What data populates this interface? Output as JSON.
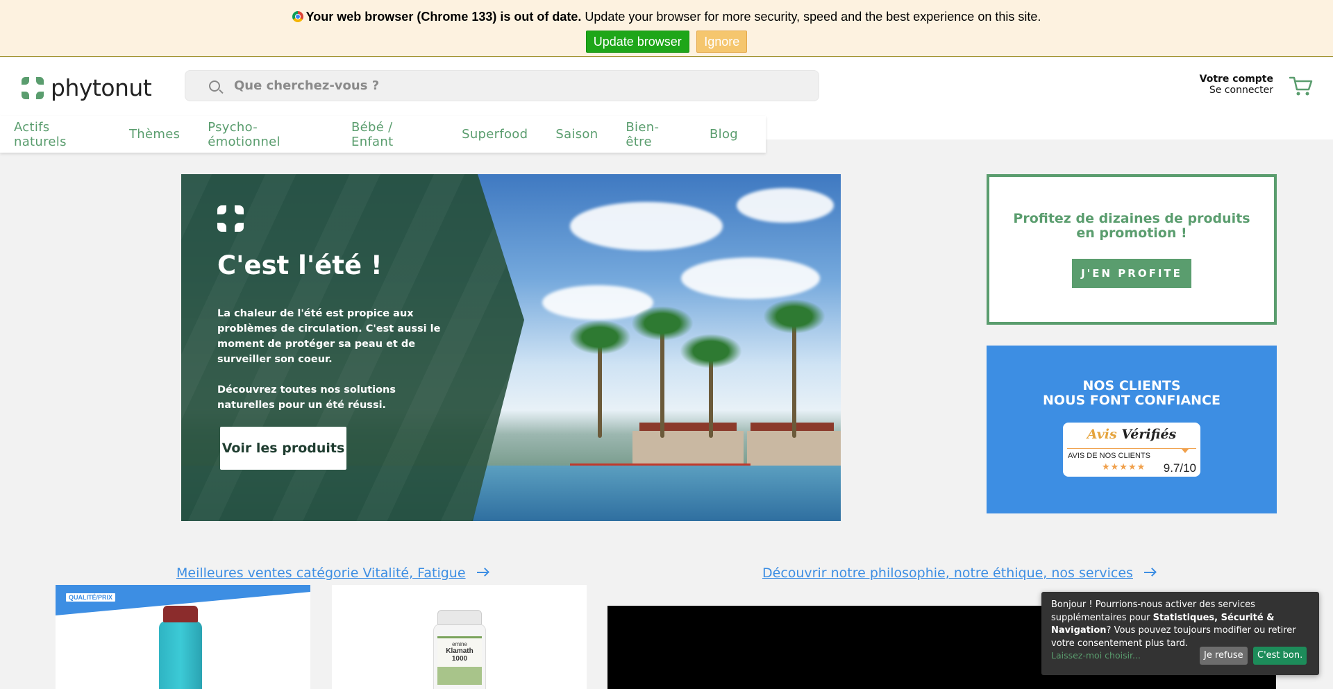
{
  "browser_warning": {
    "bold_text": "Your web browser (Chrome 133) is out of date.",
    "text": " Update your browser for more security, speed and the best experience on this site.",
    "update_label": "Update browser",
    "ignore_label": "Ignore"
  },
  "header": {
    "logo_text": "phytonut",
    "search_placeholder": "Que cherchez-vous ?",
    "account_title": "Votre compte",
    "account_login": "Se connecter"
  },
  "nav": {
    "items": [
      {
        "label": "Actifs naturels"
      },
      {
        "label": "Thèmes"
      },
      {
        "label": "Psycho-émotionnel"
      },
      {
        "label": "Bébé / Enfant"
      },
      {
        "label": "Superfood"
      },
      {
        "label": "Saison"
      },
      {
        "label": "Bien-être"
      },
      {
        "label": "Blog"
      }
    ]
  },
  "hero": {
    "title": "C'est l'été !",
    "paragraph1": "La chaleur de l'été est propice aux problèmes de circulation. C'est aussi le moment de protéger sa peau et de surveiller son coeur.",
    "paragraph2": "Découvrez toutes nos solutions naturelles pour un été réussi.",
    "button_label": "Voir les produits"
  },
  "promo": {
    "text": "Profitez de dizaines de produits en promotion !",
    "button_label": "J'EN PROFITE"
  },
  "trust": {
    "title_line1": "NOS CLIENTS",
    "title_line2": "NOUS FONT CONFIANCE",
    "brand_a": "Avis",
    "brand_b": "Vérifiés",
    "subtitle": "AVIS DE NOS CLIENTS",
    "stars": "★★★★★",
    "score": "9.7/10"
  },
  "links": {
    "best_sellers": "Meilleures ventes catégorie Vitalité, Fatigue",
    "philosophy": "Découvrir notre philosophie, notre éthique, nos services"
  },
  "products": {
    "badge": "QUALITÉ/PRIX",
    "card2_brand": "emine",
    "card2_name": "Klamath 1000"
  },
  "cookie": {
    "text_before": "Bonjour ! Pourrions-nous activer des services supplémentaires pour ",
    "text_bold": "Statistiques, Sécurité & Navigation",
    "text_after": "? Vous pouvez toujours modifier ou retirer votre consentement plus tard.",
    "more_label": "Laissez-moi choisir...",
    "refuse_label": "Je refuse",
    "accept_label": "C'est bon."
  },
  "colors": {
    "brand_green": "#5a9d6e",
    "accent_blue": "#3d8ee3",
    "hero_green": "#264f3c"
  }
}
